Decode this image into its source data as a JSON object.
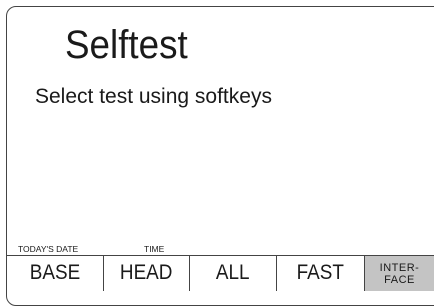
{
  "screen": {
    "title": "Selftest",
    "subtitle": "Select test using softkeys"
  },
  "status": {
    "date_label": "TODAY'S DATE",
    "time_label": "TIME"
  },
  "softkeys": [
    {
      "label": "BASE"
    },
    {
      "label": "HEAD"
    },
    {
      "label": "ALL"
    },
    {
      "label": "FAST"
    },
    {
      "label_line1": "INTER-",
      "label_line2": "FACE"
    }
  ],
  "colors": {
    "border": "#444444",
    "text": "#1a1a1a",
    "selected_key_bg": "#c4c4c4",
    "background": "#ffffff"
  }
}
